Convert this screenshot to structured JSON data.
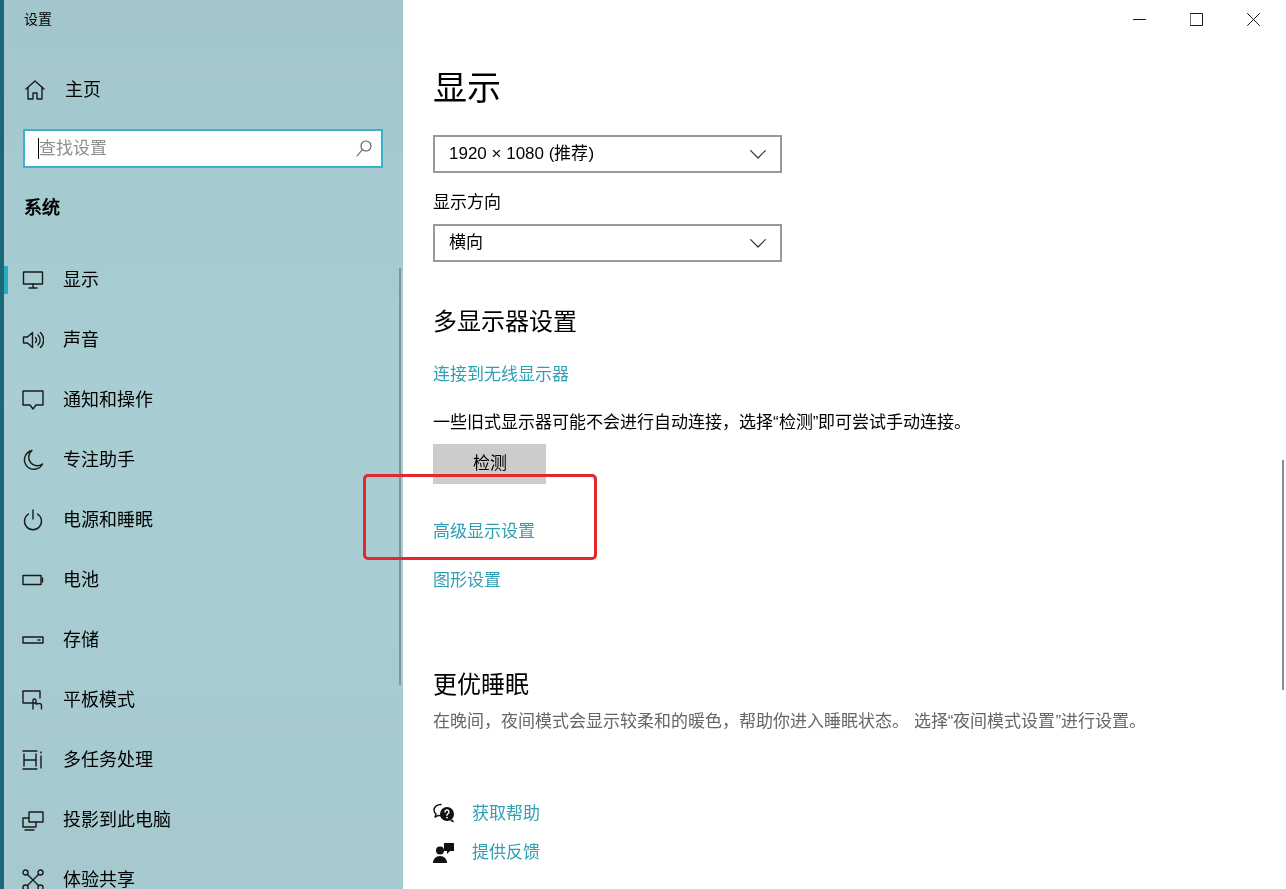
{
  "window": {
    "title": "设置"
  },
  "sidebar": {
    "home": {
      "label": "主页"
    },
    "search": {
      "placeholder": "查找设置",
      "focused": true
    },
    "section": "系统",
    "items": [
      {
        "label": "显示",
        "selected": true
      },
      {
        "label": "声音",
        "selected": false
      },
      {
        "label": "通知和操作",
        "selected": false
      },
      {
        "label": "专注助手",
        "selected": false
      },
      {
        "label": "电源和睡眠",
        "selected": false
      },
      {
        "label": "电池",
        "selected": false
      },
      {
        "label": "存储",
        "selected": false
      },
      {
        "label": "平板模式",
        "selected": false
      },
      {
        "label": "多任务处理",
        "selected": false
      },
      {
        "label": "投影到此电脑",
        "selected": false
      },
      {
        "label": "体验共享",
        "selected": false
      }
    ]
  },
  "page": {
    "title": "显示",
    "resolution": {
      "value": "1920 × 1080 (推荐)"
    },
    "orientation": {
      "label": "显示方向",
      "value": "横向"
    },
    "multiple_displays": {
      "heading": "多显示器设置",
      "link": "连接到无线显示器",
      "note": "一些旧式显示器可能不会进行自动连接，选择“检测”即可尝试手动连接。",
      "button": "检测"
    },
    "links": [
      "高级显示设置",
      "图形设置"
    ],
    "sleep": {
      "heading": "更优睡眠",
      "text": "在晚间，夜间模式会显示较柔和的暖色，帮助你进入睡眠状态。 选择“夜间模式设置”进行设置。"
    },
    "help_links": [
      "获取帮助",
      "提供反馈"
    ]
  },
  "annotations": [
    {
      "kind": "frame"
    }
  ]
}
